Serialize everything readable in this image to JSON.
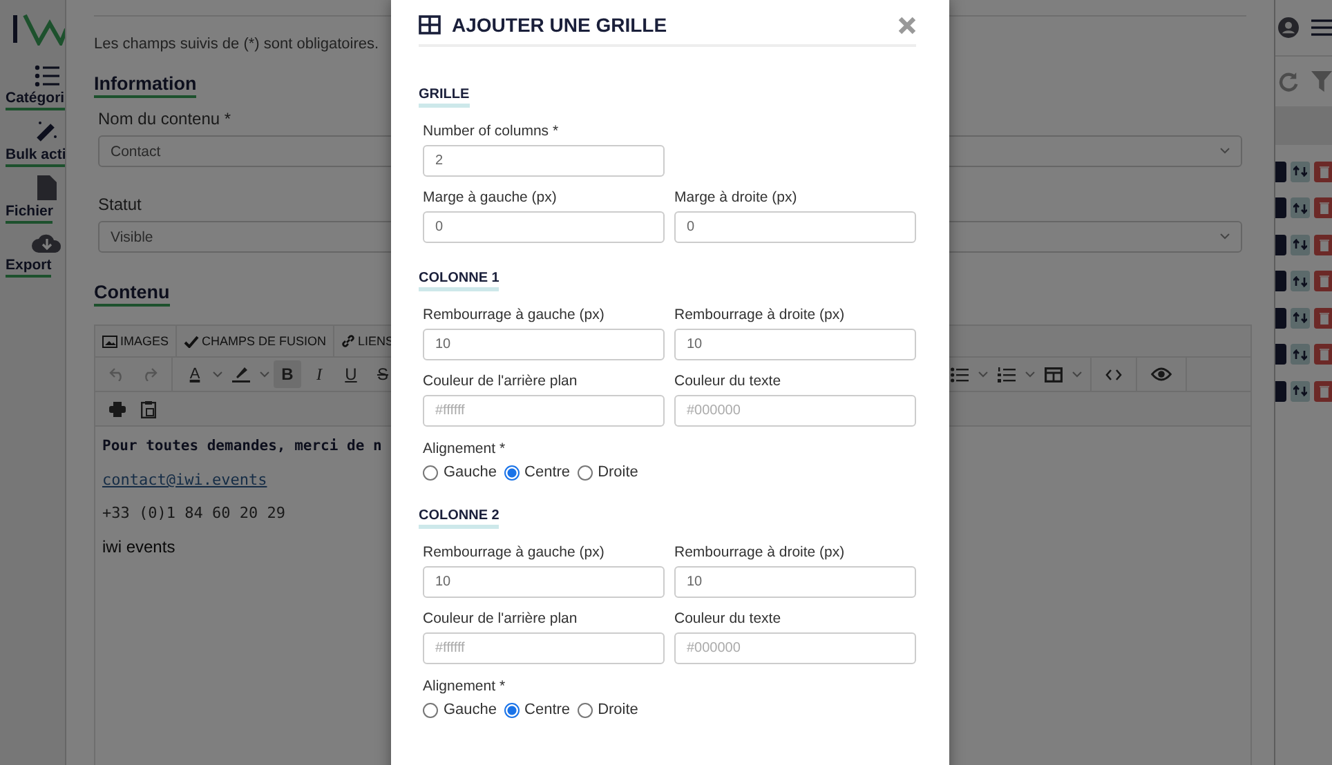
{
  "sidebar": {
    "items": [
      {
        "label": "Catégori",
        "kind": "list"
      },
      {
        "label": "Bulk acti",
        "kind": "wand"
      },
      {
        "label": "Fichier",
        "kind": "file"
      },
      {
        "label": "Export",
        "kind": "cloud"
      }
    ]
  },
  "editor_panel": {
    "notice": "Les champs suivis de (*) sont obligatoires.",
    "information_heading": "Information",
    "fields": [
      {
        "label": "Nom du contenu *",
        "value": "Contact"
      },
      {
        "label": "Statut",
        "value": "Visible"
      }
    ],
    "content_heading": "Contenu",
    "editor": {
      "tabs": [
        {
          "label": "IMAGES",
          "kind": "image"
        },
        {
          "label": "CHAMPS DE FUSION",
          "kind": "check"
        },
        {
          "label": "LIENS",
          "kind": "link"
        }
      ],
      "text_color_label": "A",
      "format_buttons": [
        {
          "label": "B",
          "kind": "bold",
          "active": true
        },
        {
          "label": "I",
          "kind": "italic",
          "active": false
        },
        {
          "label": "U",
          "kind": "underline",
          "active": false
        },
        {
          "label": "S",
          "kind": "strike",
          "active": false
        }
      ],
      "lines": [
        {
          "kind": "bold",
          "text": "Pour toutes demandes, merci de n"
        },
        {
          "kind": "link",
          "text": "contact@iwi.events"
        },
        {
          "kind": "mono",
          "text": "+33 (0)1 84 60 20 29"
        },
        {
          "kind": "plain",
          "text": "iwi events"
        }
      ]
    }
  },
  "modal": {
    "title": "AJOUTER UNE GRILLE",
    "grid": {
      "heading": "GRILLE",
      "columns_field": {
        "label": "Number of columns *",
        "value": "2"
      },
      "margins": [
        {
          "label": "Marge à gauche (px)",
          "value": "0"
        },
        {
          "label": "Marge à droite (px)",
          "value": "0"
        }
      ]
    },
    "columns": [
      {
        "heading": "COLONNE 1",
        "fields": [
          {
            "label": "Rembourrage à gauche (px)",
            "value": "10"
          },
          {
            "label": "Rembourrage à droite (px)",
            "value": "10"
          },
          {
            "label": "Couleur de l'arrière plan",
            "placeholder": "#ffffff"
          },
          {
            "label": "Couleur du texte",
            "placeholder": "#000000"
          }
        ],
        "alignment": {
          "label": "Alignement *",
          "options": [
            {
              "label": "Gauche",
              "selected": false
            },
            {
              "label": "Centre",
              "selected": true
            },
            {
              "label": "Droite",
              "selected": false
            }
          ]
        }
      },
      {
        "heading": "COLONNE 2",
        "fields": [
          {
            "label": "Rembourrage à gauche (px)",
            "value": "10"
          },
          {
            "label": "Rembourrage à droite (px)",
            "value": "10"
          },
          {
            "label": "Couleur de l'arrière plan",
            "placeholder": "#ffffff"
          },
          {
            "label": "Couleur du texte",
            "placeholder": "#000000"
          }
        ],
        "alignment": {
          "label": "Alignement *",
          "options": [
            {
              "label": "Gauche",
              "selected": false
            },
            {
              "label": "Centre",
              "selected": true
            },
            {
              "label": "Droite",
              "selected": false
            }
          ]
        }
      }
    ]
  }
}
